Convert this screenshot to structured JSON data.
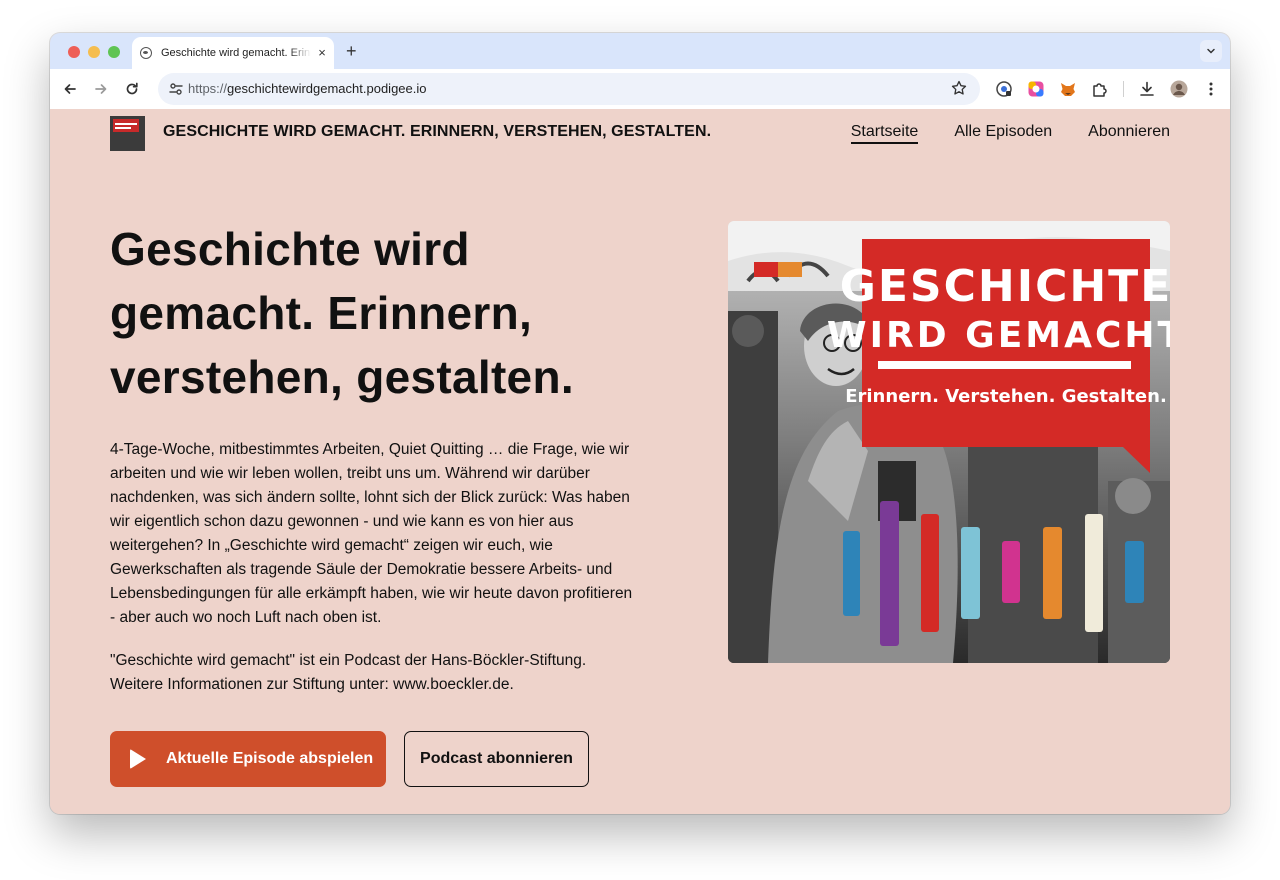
{
  "browser": {
    "tab_title": "Geschichte wird gemacht. Erinnern, verstehen, gestalten.",
    "tab_close": "×",
    "new_tab": "+",
    "url_scheme": "https://",
    "url_host": "geschichtewirdgemacht.podigee.io"
  },
  "header": {
    "site_title": "GESCHICHTE WIRD GEMACHT. ERINNERN, VERSTEHEN, GESTALTEN.",
    "nav": [
      {
        "label": "Startseite"
      },
      {
        "label": "Alle Episoden"
      },
      {
        "label": "Abonnieren"
      }
    ]
  },
  "hero": {
    "title": "Geschichte wird gemacht. Erinnern, verstehen, gestalten.",
    "description": "4-Tage-Woche, mitbestimmtes Arbeiten, Quiet Quitting … die Frage, wie wir arbeiten und wie wir leben wollen, treibt uns um. Während wir darüber nachdenken, was sich ändern sollte, lohnt sich der Blick zurück: Was haben wir eigentlich schon dazu gewonnen - und wie kann es von hier aus weitergehen? In „Geschichte wird gemacht“ zeigen wir euch, wie Gewerkschaften als tragende Säule der Demokratie bessere Arbeits- und Lebensbedingungen für alle erkämpft haben, wie wir heute davon profitieren - aber auch wo noch Luft nach oben ist.",
    "note": "\"Geschichte wird gemacht\" ist ein Podcast der Hans-Böckler-Stiftung. Weitere Informationen zur Stiftung unter: www.boeckler.de.",
    "play_button": "Aktuelle Episode abspielen",
    "subscribe_button": "Podcast abonnieren"
  },
  "cover": {
    "line1": "GESCHICHTE",
    "line2": "WIRD GEMACHT",
    "tagline": "Erinnern. Verstehen. Gestalten."
  },
  "colors": {
    "page_bg": "#eed3cb",
    "primary_button": "#cf4f2b",
    "cover_red": "#d42a26",
    "tabbar": "#d9e5fb"
  }
}
